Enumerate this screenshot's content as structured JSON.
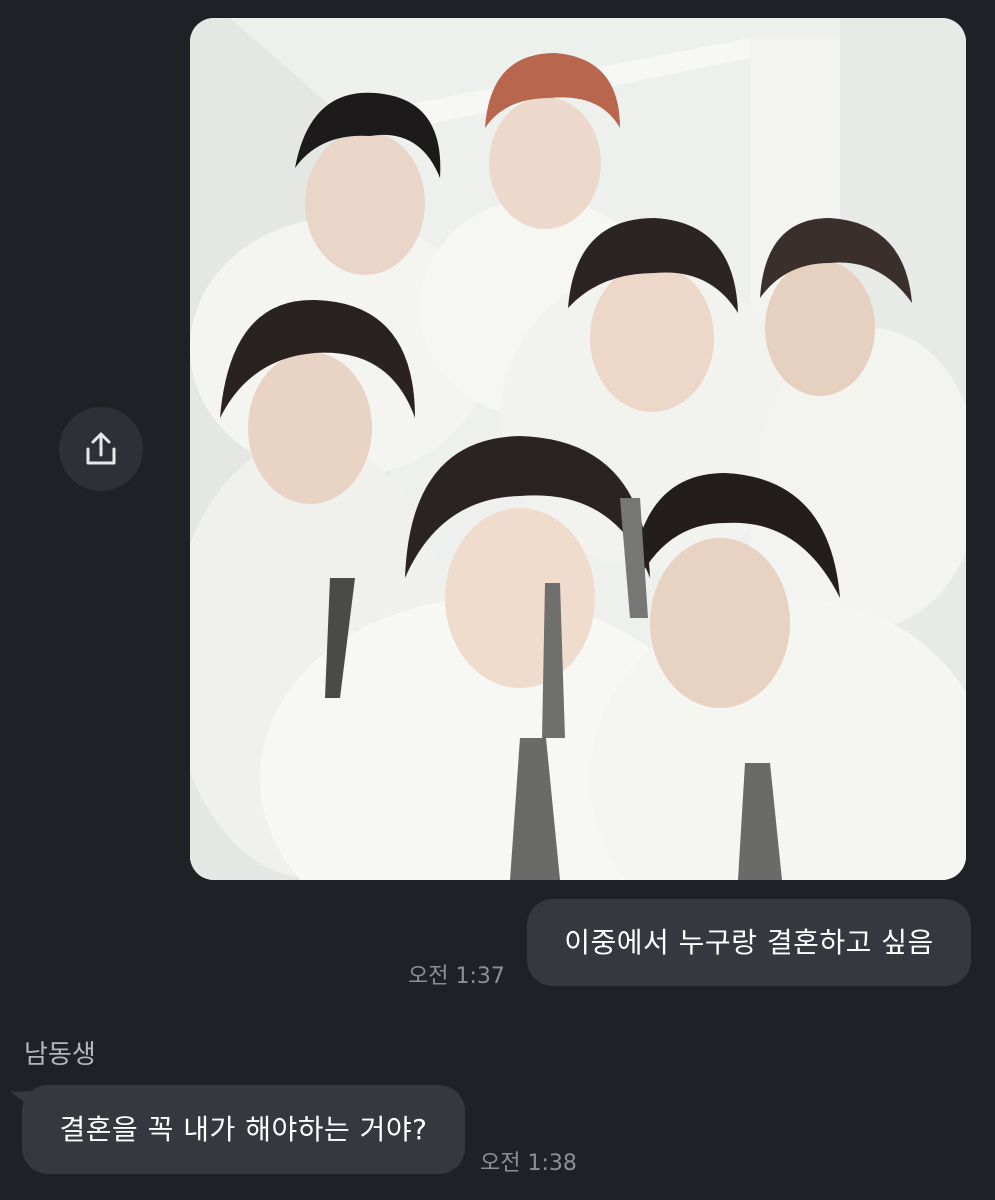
{
  "chat": {
    "outgoing": {
      "message": "이중에서 누구랑 결혼하고 싶음",
      "time": "오전 1:37"
    },
    "incoming": {
      "sender": "남동생",
      "message": "결혼을 꼭 내가 해야하는 거야?",
      "time": "오전 1:38"
    },
    "photo": {
      "subject": "group-photo-seven-people-white-shirts-grey-ties"
    },
    "icons": {
      "share": "share-upload-icon"
    },
    "colors": {
      "background": "#1f2127",
      "bubble": "#35383f",
      "text": "#ffffff",
      "timestamp": "#8b8f97",
      "share_button": "#2d3037"
    }
  }
}
